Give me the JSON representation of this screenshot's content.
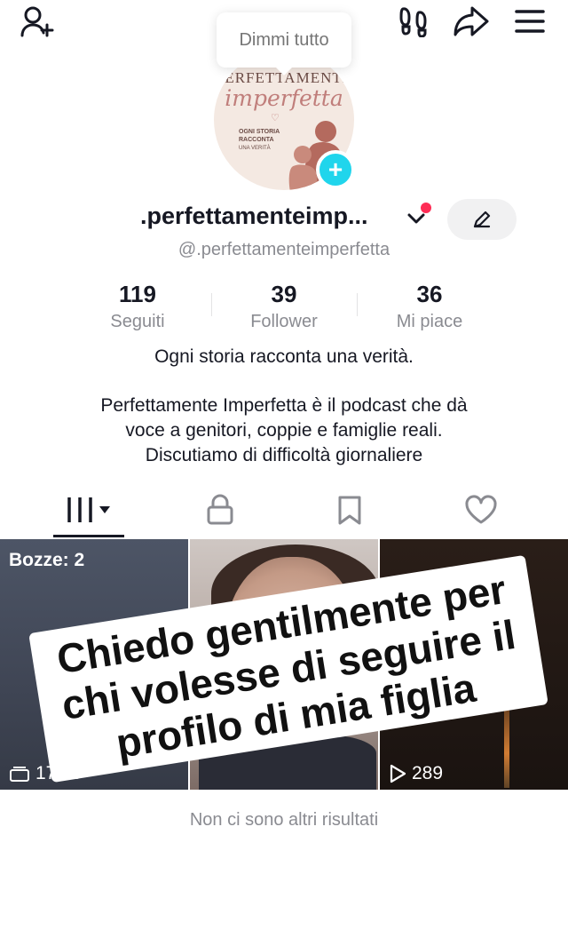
{
  "header": {
    "add_friend_icon": "add-user-icon",
    "footprint_icon": "footprints-icon",
    "share_icon": "share-arrow-icon",
    "menu_icon": "hamburger-menu-icon"
  },
  "tooltip": {
    "text": "Dimmi tutto"
  },
  "avatar": {
    "line1": "PERFETTAMENTE",
    "line2": "imperfetta",
    "line3": "OGNI STORIA RACCONTA",
    "line4": "UNA VERITÀ"
  },
  "profile": {
    "display_name": ".perfettamenteimp...",
    "handle": "@.perfettamenteimperfetta",
    "edit_icon": "pencil-icon"
  },
  "stats": [
    {
      "value": "119",
      "label": "Seguiti"
    },
    {
      "value": "39",
      "label": "Follower"
    },
    {
      "value": "36",
      "label": "Mi piace"
    }
  ],
  "bio": {
    "line1": "Ogni storia racconta una verità.",
    "line2": "Perfettamente Imperfetta è il podcast che dà",
    "line3": "voce a genitori, coppie e famiglie reali.",
    "line4": "Discutiamo di difficoltà giornaliere"
  },
  "tabs": [
    {
      "icon": "videos-grid-icon"
    },
    {
      "icon": "lock-icon"
    },
    {
      "icon": "bookmark-icon"
    },
    {
      "icon": "heart-icon"
    }
  ],
  "videos": [
    {
      "badge": "Bozze: 2",
      "views": "179.9"
    },
    {
      "views": ""
    },
    {
      "views": "289"
    }
  ],
  "overlay": {
    "line1": "Chiedo gentilmente per",
    "line2": "chi volesse di seguire il",
    "line3": "profilo di mia figlia"
  },
  "footer": {
    "text": "Non ci sono altri risultati"
  },
  "colors": {
    "accent": "#fe2c55",
    "badge": "#20d5ec",
    "text": "#161823",
    "muted": "#8a8b91"
  }
}
